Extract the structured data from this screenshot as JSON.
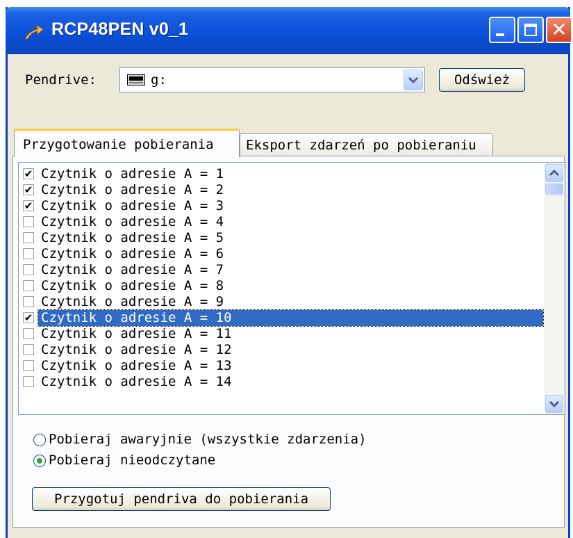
{
  "window": {
    "title": "RCP48PEN v0_1"
  },
  "pendrive": {
    "label": "Pendrive:",
    "selected_value": "g:",
    "refresh_label": "Odśwież"
  },
  "tabs": [
    {
      "label": "Przygotowanie pobierania"
    },
    {
      "label": "Eksport zdarzeń po pobieraniu"
    }
  ],
  "readers": [
    {
      "label": "Czytnik o adresie A = 1",
      "checked": true
    },
    {
      "label": "Czytnik o adresie A = 2",
      "checked": true
    },
    {
      "label": "Czytnik o adresie A = 3",
      "checked": true
    },
    {
      "label": "Czytnik o adresie A = 4",
      "checked": false
    },
    {
      "label": "Czytnik o adresie A = 5",
      "checked": false
    },
    {
      "label": "Czytnik o adresie A = 6",
      "checked": false
    },
    {
      "label": "Czytnik o adresie A = 7",
      "checked": false
    },
    {
      "label": "Czytnik o adresie A = 8",
      "checked": false
    },
    {
      "label": "Czytnik o adresie A = 9",
      "checked": false
    },
    {
      "label": "Czytnik o adresie A = 10",
      "checked": true,
      "selected": true
    },
    {
      "label": "Czytnik o adresie A = 11",
      "checked": false
    },
    {
      "label": "Czytnik o adresie A = 12",
      "checked": false
    },
    {
      "label": "Czytnik o adresie A = 13",
      "checked": false
    },
    {
      "label": "Czytnik o adresie A = 14",
      "checked": false
    }
  ],
  "options": {
    "emergency_label": "Pobieraj awaryjnie (wszystkie zdarzenia)",
    "unread_label": "Pobieraj nieodczytane",
    "selected": "unread"
  },
  "prepare_button": {
    "label": "Przygotuj pendriva do pobierania"
  },
  "colors": {
    "title_bar": "#0a4fd6",
    "selection": "#316ac5",
    "tab_accent": "#ffc83c",
    "close_button": "#d44120"
  },
  "icons": {
    "app": "app-arrow-icon",
    "drive": "drive-icon"
  }
}
